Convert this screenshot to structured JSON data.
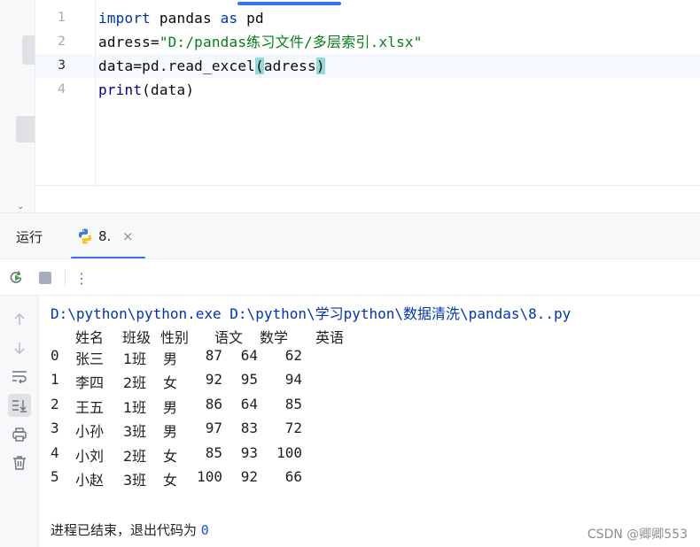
{
  "editor": {
    "lines": [
      {
        "number": "1",
        "tokens": [
          {
            "t": "import",
            "k": "kw"
          },
          {
            "t": " pandas ",
            "k": ""
          },
          {
            "t": "as",
            "k": "kw"
          },
          {
            "t": " pd",
            "k": ""
          }
        ]
      },
      {
        "number": "2",
        "tokens": [
          {
            "t": "adress=",
            "k": ""
          },
          {
            "t": "\"D:/pandas练习文件/多层索引.xlsx\"",
            "k": "str"
          }
        ]
      },
      {
        "number": "3",
        "tokens": [
          {
            "t": "data=pd.read_excel",
            "k": ""
          },
          {
            "t": "(",
            "k": "paren"
          },
          {
            "t": "adress",
            "k": ""
          },
          {
            "t": ")",
            "k": "paren"
          }
        ]
      },
      {
        "number": "4",
        "tokens": [
          {
            "t": "print",
            "k": "fn"
          },
          {
            "t": "(data)",
            "k": ""
          }
        ]
      }
    ],
    "active_line": 3
  },
  "run_panel": {
    "title": "运行",
    "tab_label": "8.",
    "tab_close": "×",
    "more_label": "⋮"
  },
  "console": {
    "command": "D:\\python\\python.exe D:\\python\\学习python\\数据清洗\\pandas\\8..py",
    "columns": [
      "姓名",
      "班级",
      "性别",
      "语文",
      "数学",
      "英语"
    ],
    "rows": [
      {
        "index": "0",
        "name": "张三",
        "class": "1班",
        "gender": "男",
        "chinese": "87",
        "math": "64",
        "english": "62"
      },
      {
        "index": "1",
        "name": "李四",
        "class": "2班",
        "gender": "女",
        "chinese": "92",
        "math": "95",
        "english": "94"
      },
      {
        "index": "2",
        "name": "王五",
        "class": "1班",
        "gender": "男",
        "chinese": "86",
        "math": "64",
        "english": "85"
      },
      {
        "index": "3",
        "name": "小孙",
        "class": "3班",
        "gender": "男",
        "chinese": "97",
        "math": "83",
        "english": "72"
      },
      {
        "index": "4",
        "name": "小刘",
        "class": "2班",
        "gender": "女",
        "chinese": "85",
        "math": "93",
        "english": "100"
      },
      {
        "index": "5",
        "name": "小赵",
        "class": "3班",
        "gender": "女",
        "chinese": "100",
        "math": "92",
        "english": "66"
      }
    ],
    "exit_text": "进程已结束，退出代码为 ",
    "exit_code": "0"
  },
  "watermark": "CSDN @卿卿553",
  "colors": {
    "accent": "#3574f0",
    "keyword": "#0033b3",
    "string": "#067d17",
    "paren_match": "#93d9d9"
  }
}
